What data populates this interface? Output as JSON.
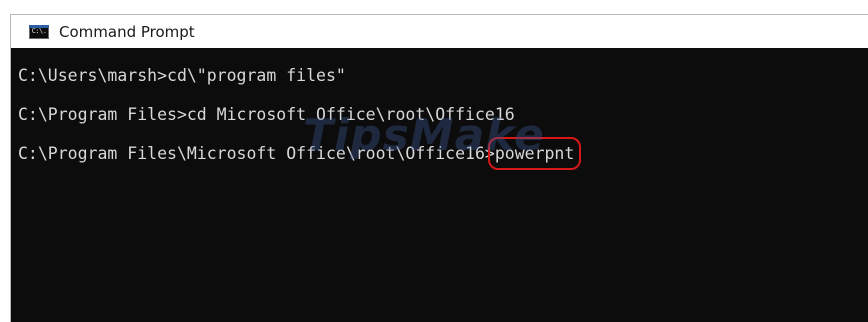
{
  "window": {
    "title": "Command Prompt",
    "icon": "console-app-icon",
    "icon_glyph": "C:\\."
  },
  "console": {
    "lines": [
      "C:\\Users\\marsh>cd\\\"program files\"",
      "C:\\Program Files>cd Microsoft Office\\root\\Office16",
      "C:\\Program Files\\Microsoft Office\\root\\Office16>"
    ],
    "highlighted_command": "powerpnt",
    "highlight_color": "#d81818",
    "background_color": "#0c0c0c",
    "text_color": "#d8d8d8"
  },
  "watermark": {
    "text": "TipsMake"
  }
}
